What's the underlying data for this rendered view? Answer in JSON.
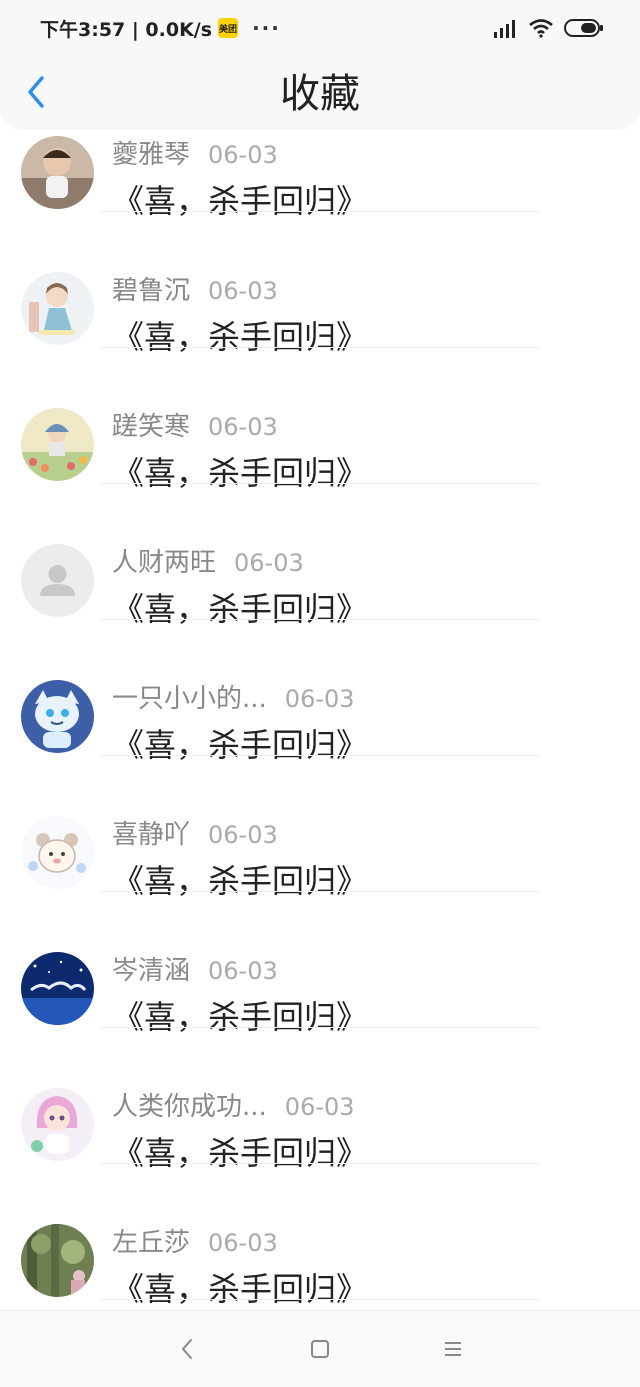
{
  "status_bar": {
    "time_and_speed": "下午3:57 | 0.0K/s",
    "app_badge": "美团",
    "overflow_dots": "···"
  },
  "header": {
    "title": "收藏"
  },
  "items": [
    {
      "username": "夔雅琴",
      "date": "06-03",
      "content": "《喜，杀手回归》",
      "avatar": "photo-child"
    },
    {
      "username": "碧鲁沉",
      "date": "06-03",
      "content": "《喜，杀手回归》",
      "avatar": "illustration-girl"
    },
    {
      "username": "蹉笑寒",
      "date": "06-03",
      "content": "《喜，杀手回归》",
      "avatar": "illustration-flowers"
    },
    {
      "username": "人财两旺",
      "date": "06-03",
      "content": "《喜，杀手回归》",
      "avatar": "default-avatar"
    },
    {
      "username": "一只小小的...",
      "date": "06-03",
      "content": "《喜，杀手回归》",
      "avatar": "cartoon-creature"
    },
    {
      "username": "喜静吖",
      "date": "06-03",
      "content": "《喜，杀手回归》",
      "avatar": "cartoon-bear"
    },
    {
      "username": "岑清涵",
      "date": "06-03",
      "content": "《喜，杀手回归》",
      "avatar": "night-sky"
    },
    {
      "username": "人类你成功...",
      "date": "06-03",
      "content": "《喜，杀手回归》",
      "avatar": "doll-girl"
    },
    {
      "username": "左丘莎",
      "date": "06-03",
      "content": "《喜，杀手回归》",
      "avatar": "photo-garden"
    }
  ],
  "colors": {
    "accent": "#2d8cf0",
    "username": "#888888",
    "date": "#aaaaaa",
    "content": "#222222"
  }
}
